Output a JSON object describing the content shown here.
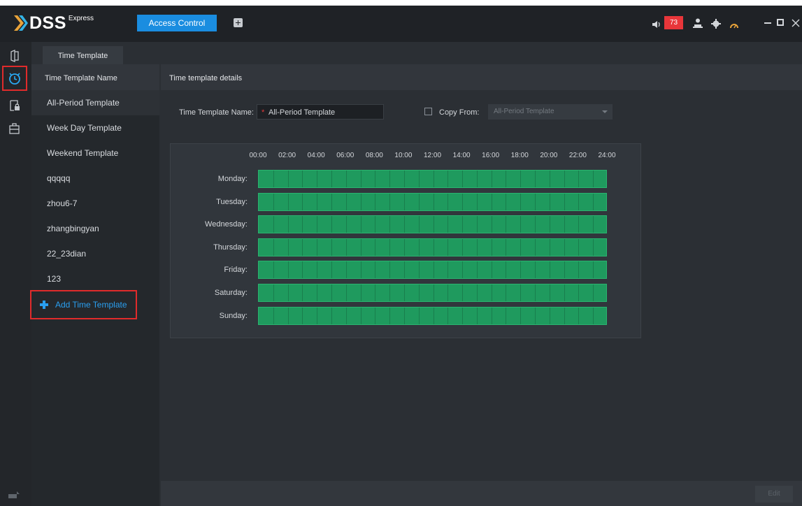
{
  "app": {
    "brand": "DSS",
    "edition": "Express",
    "module_tab": "Access Control",
    "alarm_count": "73"
  },
  "tabs": [
    {
      "label": "Time Template"
    }
  ],
  "list": {
    "header": "Time Template Name",
    "items": [
      {
        "label": "All-Period Template"
      },
      {
        "label": "Week Day Template"
      },
      {
        "label": "Weekend Template"
      },
      {
        "label": "qqqqq"
      },
      {
        "label": "zhou6-7"
      },
      {
        "label": "zhangbingyan"
      },
      {
        "label": "22_23dian"
      },
      {
        "label": "123"
      }
    ],
    "add_label": "Add Time Template"
  },
  "details": {
    "header": "Time template details",
    "name_label": "Time Template Name:",
    "name_required": "*",
    "name_value": "All-Period Template",
    "copy_label": "Copy From:",
    "copy_value": "All-Period Template",
    "hours": [
      "00:00",
      "02:00",
      "04:00",
      "06:00",
      "08:00",
      "10:00",
      "12:00",
      "14:00",
      "16:00",
      "18:00",
      "20:00",
      "22:00",
      "24:00"
    ],
    "days": [
      {
        "label": "Monday:",
        "periods": [
          [
            0,
            24
          ]
        ]
      },
      {
        "label": "Tuesday:",
        "periods": [
          [
            0,
            24
          ]
        ]
      },
      {
        "label": "Wednesday:",
        "periods": [
          [
            0,
            24
          ]
        ]
      },
      {
        "label": "Thursday:",
        "periods": [
          [
            0,
            24
          ]
        ]
      },
      {
        "label": "Friday:",
        "periods": [
          [
            0,
            24
          ]
        ]
      },
      {
        "label": "Saturday:",
        "periods": [
          [
            0,
            24
          ]
        ]
      },
      {
        "label": "Sunday:",
        "periods": [
          [
            0,
            24
          ]
        ]
      }
    ],
    "edit_label": "Edit"
  },
  "colors": {
    "accent": "#1a8de0",
    "period_fill": "#1f9a5e",
    "alarm_badge": "#e8363a",
    "highlight_box": "#e02b2b"
  }
}
